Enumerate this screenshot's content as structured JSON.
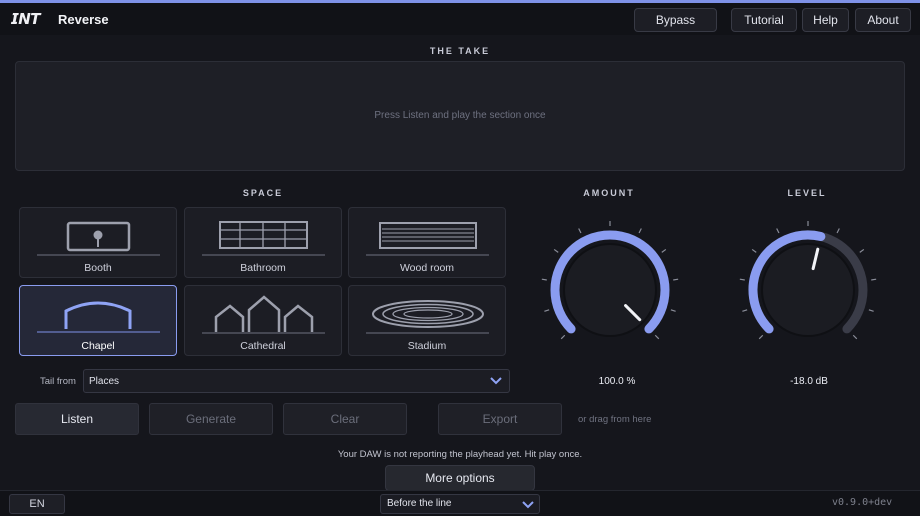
{
  "header": {
    "logo": "𝙄𝙉𝙏",
    "title": "Reverse",
    "buttons": [
      "Bypass",
      "Tutorial",
      "Help",
      "About"
    ]
  },
  "take": {
    "label": "THE TAKE",
    "hint": "Press Listen and play the section once"
  },
  "space": {
    "label": "SPACE",
    "tiles": [
      {
        "label": "Booth",
        "icon": "booth-icon",
        "selected": false
      },
      {
        "label": "Bathroom",
        "icon": "bathroom-icon",
        "selected": false
      },
      {
        "label": "Wood room",
        "icon": "wood-room-icon",
        "selected": false
      },
      {
        "label": "Chapel",
        "icon": "chapel-icon",
        "selected": true
      },
      {
        "label": "Cathedral",
        "icon": "cathedral-icon",
        "selected": false
      },
      {
        "label": "Stadium",
        "icon": "stadium-icon",
        "selected": false
      }
    ],
    "tail_label": "Tail from",
    "tail_value": "Places"
  },
  "amount": {
    "label": "AMOUNT",
    "value_text": "100.0 %",
    "level": 1.0
  },
  "level": {
    "label": "LEVEL",
    "value_text": "-18.0 dB",
    "level": 0.55
  },
  "actions": {
    "listen": "Listen",
    "generate": "Generate",
    "clear": "Clear",
    "export": "Export",
    "drag_hint": "or drag from here"
  },
  "status": {
    "daw_note": "Your DAW is not reporting the playhead yet. Hit play once."
  },
  "more_options": "More options",
  "footer": {
    "language": "EN",
    "mode_value": "Before the line",
    "version": "v0.9.0+dev"
  },
  "colors": {
    "accent": "#8a9cf0",
    "background": "#15161c",
    "panel": "#1e1f26",
    "knob_track": "#3a3c48"
  }
}
